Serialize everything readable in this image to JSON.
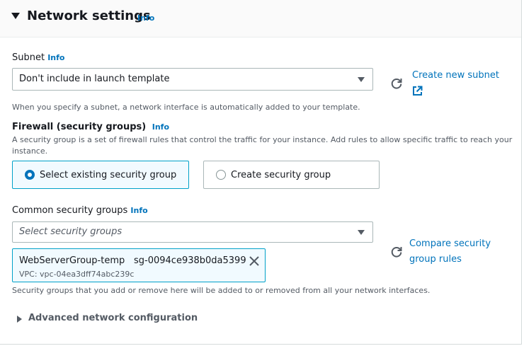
{
  "header": {
    "title": "Network settings",
    "info": "Info"
  },
  "subnet": {
    "label": "Subnet",
    "info": "Info",
    "value": "Don't include in launch template",
    "create_link": "Create new subnet",
    "description": "When you specify a subnet, a network interface is automatically added to your template."
  },
  "firewall": {
    "label": "Firewall (security groups)",
    "info": "Info",
    "description_line1": "A security group is a set of firewall rules that control the traffic for your instance. Add rules to allow specific traffic to reach your",
    "description_line2": "instance.",
    "options": [
      {
        "label": "Select existing security group",
        "selected": true
      },
      {
        "label": "Create security group",
        "selected": false
      }
    ]
  },
  "common_sg": {
    "label": "Common security groups",
    "info": "Info",
    "placeholder": "Select security groups",
    "compare_link_line1": "Compare security",
    "compare_link_line2": "group rules",
    "token": {
      "name": "WebServerGroup-temp",
      "id": "sg-0094ce938b0da5399",
      "vpc": "VPC: vpc-04ea3dff74abc239c"
    },
    "description": "Security groups that you add or remove here will be added to or removed from all your network interfaces."
  },
  "advanced": {
    "label": "Advanced network configuration"
  },
  "colors": {
    "link": "#0073bb",
    "selected_bg": "#f1faff",
    "selected_border": "#00a1c9"
  }
}
